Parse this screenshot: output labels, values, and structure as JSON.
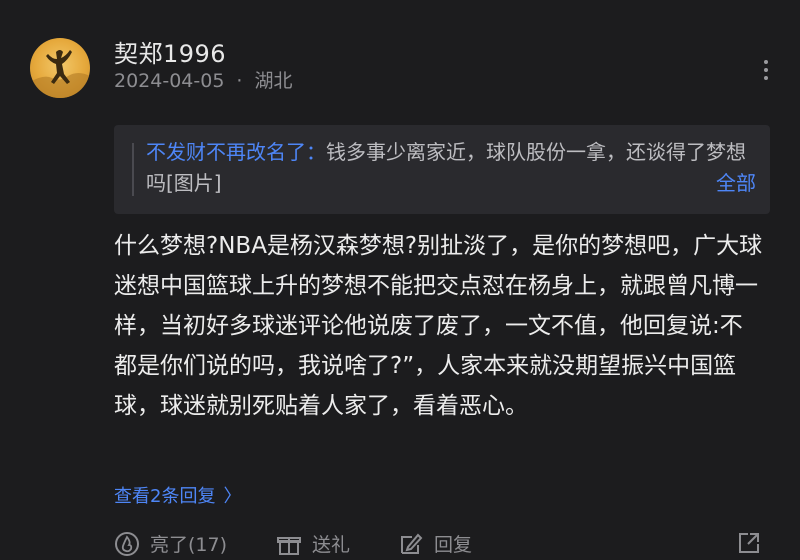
{
  "comment": {
    "username": "契郑1996",
    "date": "2024-04-05",
    "separator": "·",
    "location": "湖北",
    "quote": {
      "author": "不发财不再改名了",
      "colon": "：",
      "text": "钱多事少离家近，球队股份一拿，还谈得了梦想吗[图片]",
      "expand_label": "全部"
    },
    "body": "什么梦想?NBA是杨汉森梦想?别扯淡了，是你的梦想吧，广大球迷想中国篮球上升的梦想不能把交点怼在杨身上，就跟曾凡博一样，当初好多球迷评论他说废了废了，一文不值，他回复说:不都是你们说的吗，我说啥了?”，人家本来就没期望振兴中国篮球，球迷就别死贴着人家了，看着恶心。",
    "view_replies": "查看2条回复",
    "actions": {
      "like": "亮了(17)",
      "gift": "送礼",
      "reply": "回复"
    }
  },
  "icons": {
    "more": "more-vertical-icon",
    "like": "flame-icon",
    "gift": "gift-icon",
    "reply": "edit-icon",
    "share": "share-icon",
    "chevron": "chevron-right-icon"
  },
  "colors": {
    "background": "#1c1c1e",
    "accent": "#4e86f7",
    "quote_background": "#2a2a2e",
    "secondary_text": "#8d8d91"
  }
}
